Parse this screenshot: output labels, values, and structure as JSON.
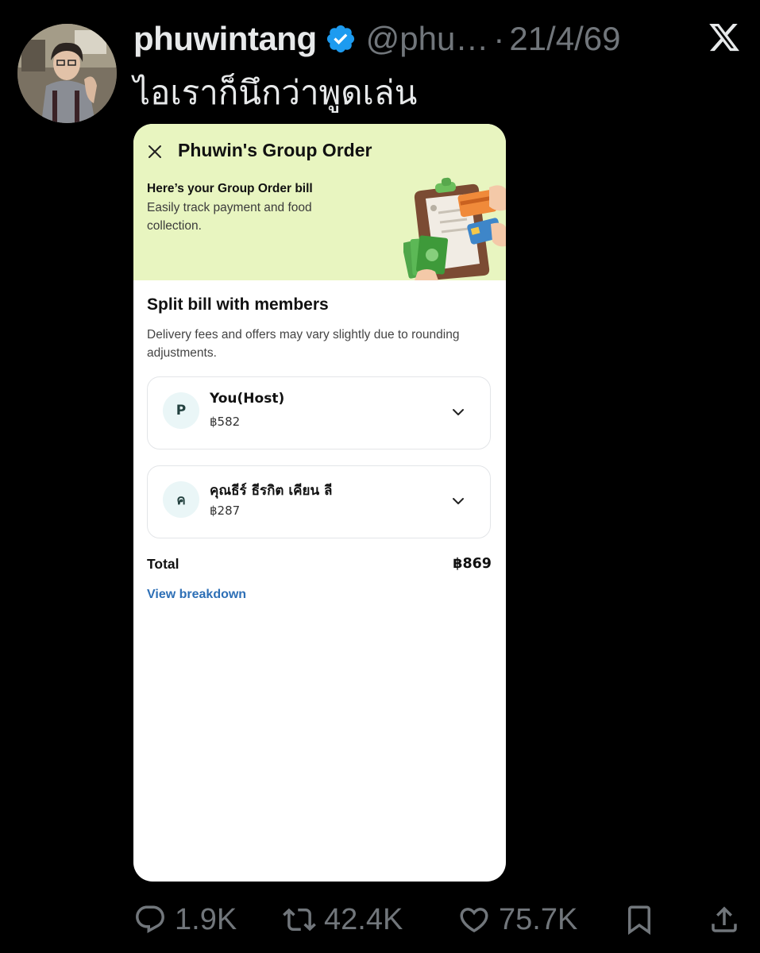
{
  "tweet": {
    "author_name": "phuwintang",
    "handle": "@phu…",
    "separator": "·",
    "date": "21/4/69",
    "text": "ไอเราก็นึกว่าพูดเล่น",
    "verified_color": "#1d9bf0",
    "avatar_icon": "profile-photo"
  },
  "app": {
    "close_icon": "close-icon",
    "title": "Phuwin's Group Order",
    "banner": {
      "heading": "Here’s your Group Order bill",
      "description": "Easily track payment and food collection.",
      "background_color": "#e8f5c0",
      "illustration_icon": "clipboard-money-illustration"
    },
    "split": {
      "title": "Split bill with members",
      "description": "Delivery fees and offers may vary slightly due to rounding adjustments."
    },
    "members": [
      {
        "initial": "P",
        "name": "You(Host)",
        "amount": "฿582"
      },
      {
        "initial": "ค",
        "name": "คุณธีร์ ธีรกิต เคียน ลี",
        "amount": "฿287"
      }
    ],
    "total_label": "Total",
    "total_amount": "฿869",
    "breakdown_link": "View breakdown",
    "link_color": "#2d6fb6"
  },
  "actions": {
    "replies": "1.9K",
    "retweets": "42.4K",
    "likes": "75.7K",
    "icons": [
      "reply-icon",
      "retweet-icon",
      "like-icon",
      "bookmark-icon",
      "share-icon"
    ]
  }
}
